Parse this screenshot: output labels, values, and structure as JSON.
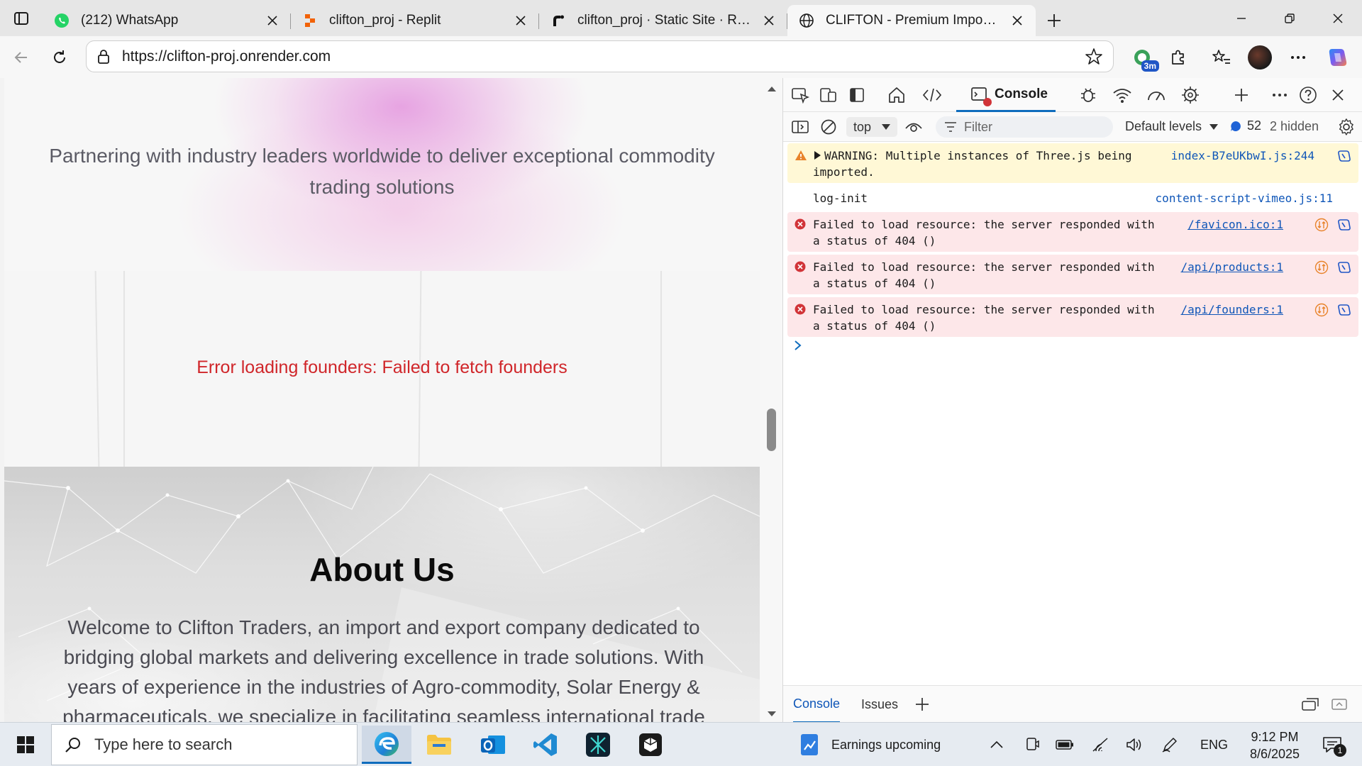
{
  "browser": {
    "tabs": [
      {
        "label": "(212) WhatsApp",
        "favicon": "whatsapp-icon"
      },
      {
        "label": "clifton_proj - Replit",
        "favicon": "replit-icon"
      },
      {
        "label": "clifton_proj · Static Site · Render",
        "favicon": "render-icon"
      },
      {
        "label": "CLIFTON - Premium Import Expor",
        "favicon": "globe-icon",
        "active": true
      }
    ],
    "url": "https://clifton-proj.onrender.com",
    "extension_badge": "3m"
  },
  "page": {
    "hero_text": "Partnering with industry leaders worldwide to deliver exceptional commodity trading solutions",
    "founders_error": "Error loading founders: Failed to fetch founders",
    "about_title": "About Us",
    "about_text": "Welcome to Clifton Traders, an import and export company dedicated to bridging global markets and delivering excellence in trade solutions. With years of experience in the industries of Agro-commodity, Solar Energy & pharmaceuticals, we specialize in facilitating seamless international trade"
  },
  "devtools": {
    "active_tab": "Console",
    "context": "top",
    "filter_placeholder": "Filter",
    "levels": "Default levels",
    "message_count": "52",
    "hidden": "2 hidden",
    "messages": [
      {
        "type": "warning",
        "text": "WARNING: Multiple instances of Three.js being imported.",
        "source": "index-B7eUKbwI.js:244"
      },
      {
        "type": "log",
        "text": "log-init",
        "source": "content-script-vimeo.js:11"
      },
      {
        "type": "error",
        "text": "Failed to load resource: the server responded with a status of 404 ()",
        "source": "/favicon.ico:1"
      },
      {
        "type": "error",
        "text": "Failed to load resource: the server responded with a status of 404 ()",
        "source": "/api/products:1"
      },
      {
        "type": "error",
        "text": "Failed to load resource: the server responded with a status of 404 ()",
        "source": "/api/founders:1"
      }
    ],
    "bottom_tabs": [
      "Console",
      "Issues"
    ]
  },
  "taskbar": {
    "search_placeholder": "Type here to search",
    "widget_text": "Earnings upcoming",
    "language": "ENG",
    "time": "9:12 PM",
    "date": "8/6/2025",
    "notifications": "1"
  }
}
